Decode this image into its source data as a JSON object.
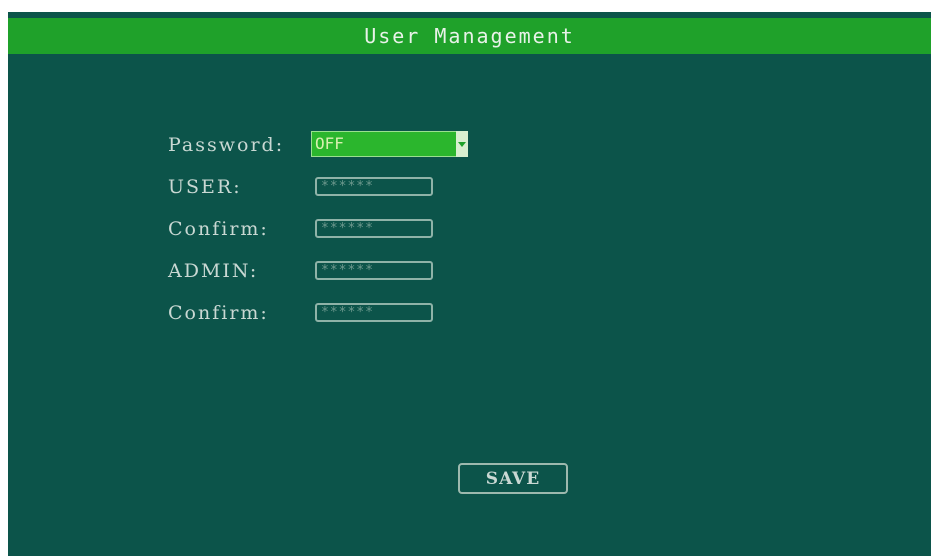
{
  "header": {
    "title": "User Management"
  },
  "form": {
    "password": {
      "label": "Password:",
      "value": "OFF",
      "arrow_icon": "chevron-down-icon"
    },
    "user": {
      "label": "USER:",
      "value": "******"
    },
    "user_confirm": {
      "label": "Confirm:",
      "value": "******"
    },
    "admin": {
      "label": "ADMIN:",
      "value": "******"
    },
    "admin_confirm": {
      "label": "Confirm:",
      "value": "******"
    }
  },
  "actions": {
    "save_label": "SAVE"
  },
  "colors": {
    "background": "#0c544a",
    "title_bar": "#1fa12a",
    "dropdown_fill": "#2bb62d",
    "text": "#c9d8d3"
  }
}
